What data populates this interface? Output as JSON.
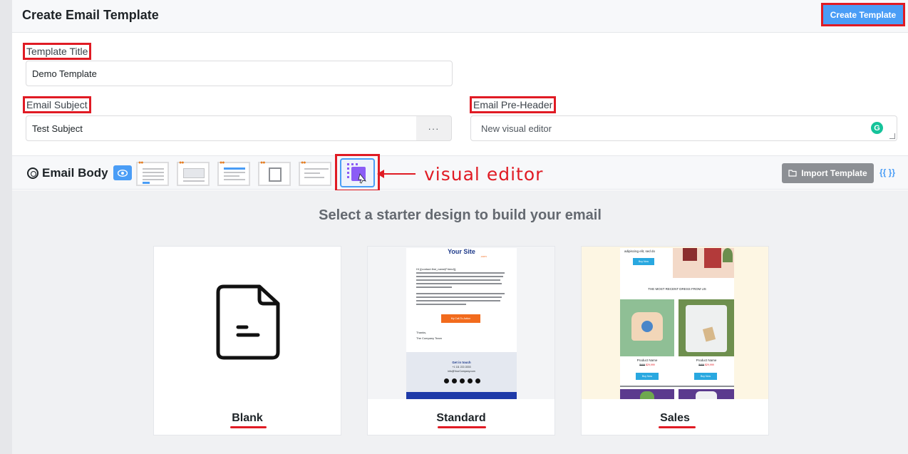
{
  "header": {
    "title": "Create Email Template",
    "create_button": "Create Template"
  },
  "fields": {
    "template_title": {
      "label": "Template Title",
      "value": "Demo Template"
    },
    "email_subject": {
      "label": "Email Subject",
      "value": "Test Subject",
      "more": "···"
    },
    "pre_header": {
      "label": "Email Pre-Header",
      "value": "New visual editor",
      "grammarly": "G"
    }
  },
  "email_body": {
    "title": "Email Body",
    "annotation": "visual editor",
    "import_button": "Import Template",
    "merge_tags": "{{ }}"
  },
  "gallery": {
    "heading": "Select a starter design to build your email",
    "cards": [
      {
        "label": "Blank"
      },
      {
        "label": "Standard",
        "brand": "Your Site",
        "brand_suffix": ".com",
        "greeting": "Hi {{contact.first_name|Friend}},",
        "cta": "My Call-To-Action",
        "signoff": "Thanks,",
        "team": "The Company Team",
        "footer_title": "Get in touch",
        "footer_phone": "+1 111 222-3333",
        "footer_email": "info@YourCompany.com"
      },
      {
        "label": "Sales",
        "intro": "adipiscing elit, sed do",
        "buy_now": "Buy Now",
        "section_title": "THE MOST RECENT DRESS FROM US",
        "product_name": "Product Name",
        "old_price": "$409",
        "new_price": "$29,999"
      }
    ]
  },
  "colors": {
    "accent": "#4a9df6",
    "annotation": "#e01b24",
    "cta_orange": "#f26b1d"
  }
}
